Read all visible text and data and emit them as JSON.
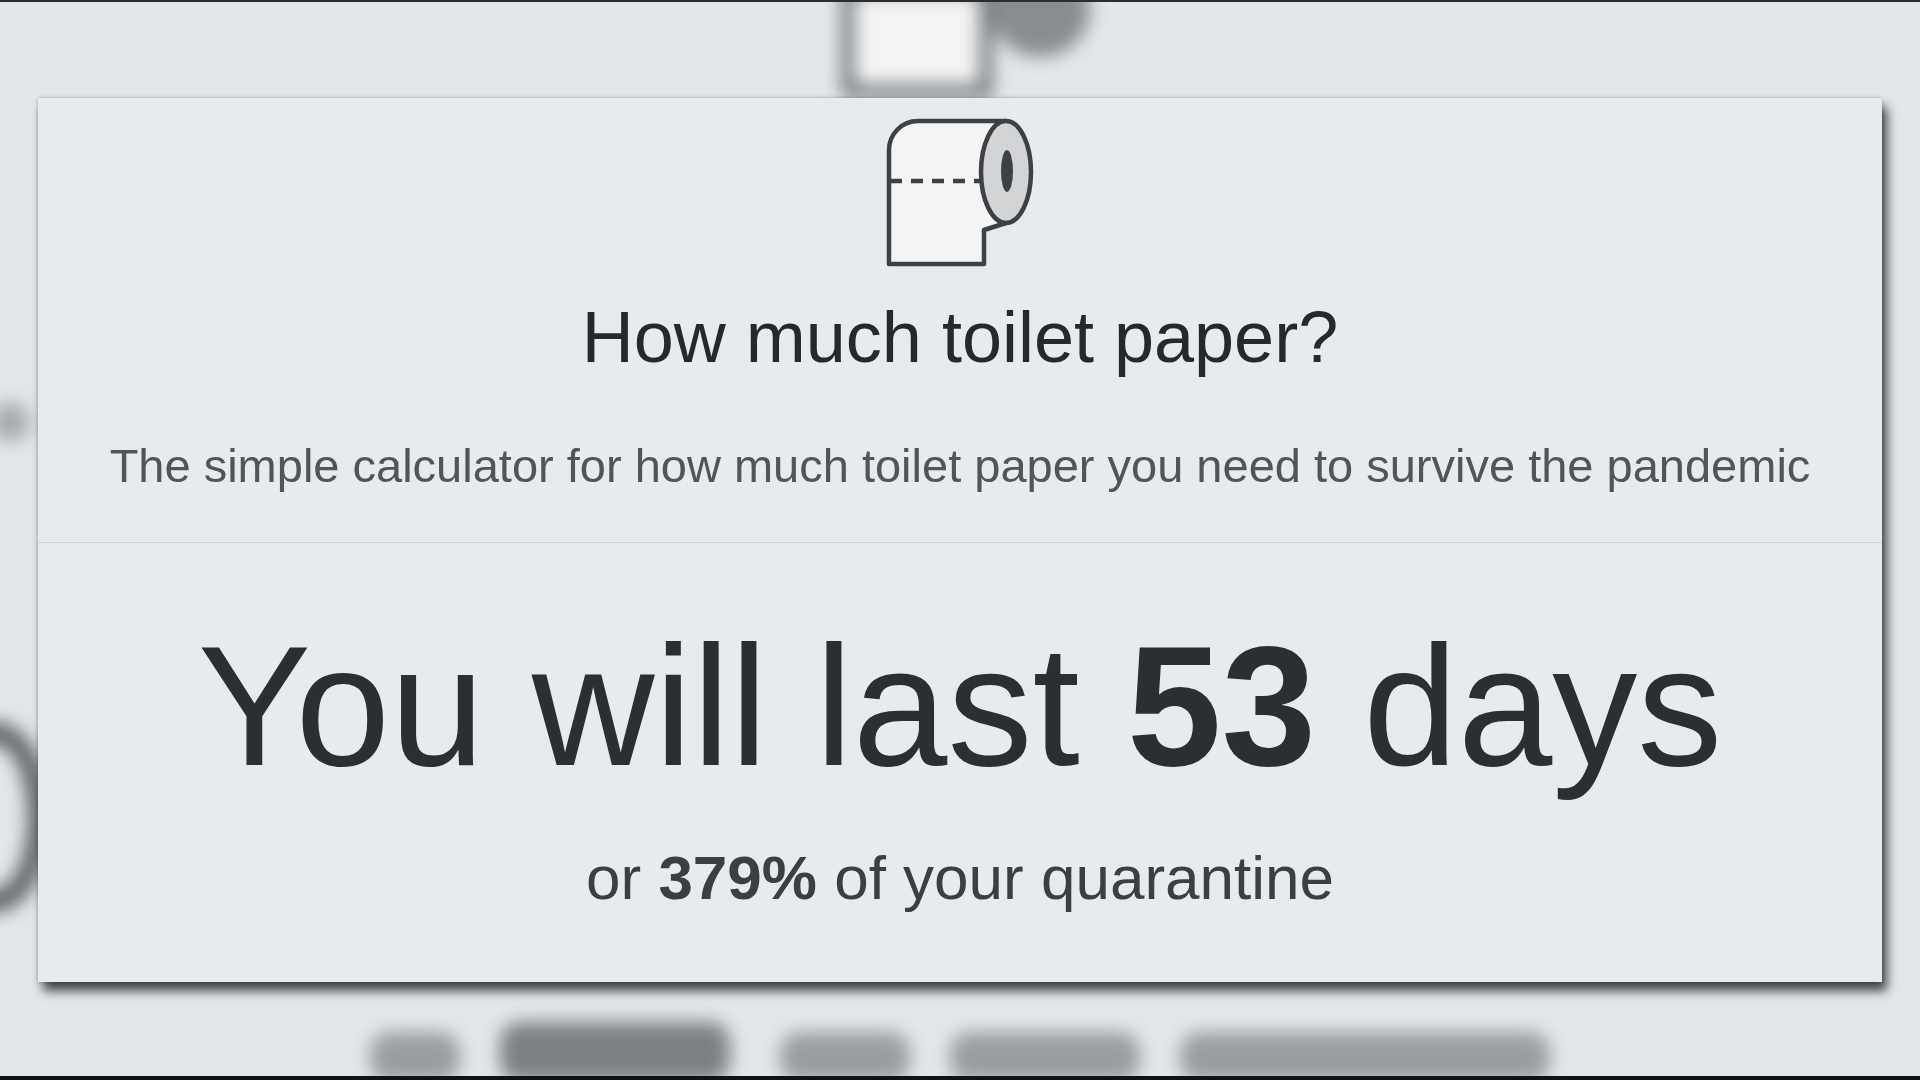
{
  "header": {
    "title": "How much toilet paper?",
    "subtitle": "The simple calculator for how much toilet paper you need to survive the pandemic"
  },
  "result": {
    "headline": "You will last **53** days",
    "detail": "or **379%** of your quarantine"
  }
}
